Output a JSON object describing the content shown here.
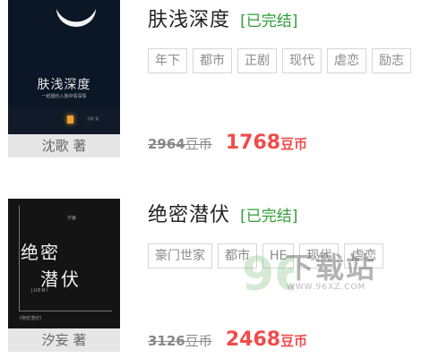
{
  "books": [
    {
      "title": "肤浅深度",
      "status": "[已完结]",
      "tags": [
        "年下",
        "都市",
        "正剧",
        "现代",
        "虐恋",
        "励志"
      ],
      "author_line": "沈歌 著",
      "old_price": "2964",
      "new_price": "1768",
      "price_unit": "豆币",
      "cover": {
        "title": "肤浅深度",
        "subtitle": "一纸婚约入我中情深情",
        "credit": "沈歌 著"
      }
    },
    {
      "title": "绝密潜伏",
      "status": "[已完结]",
      "tags": [
        "豪门世家",
        "都市",
        "HE",
        "现代",
        "虐恋"
      ],
      "author_line": "汐妄 著",
      "old_price": "3126",
      "new_price": "2468",
      "price_unit": "豆币",
      "cover": {
        "line1": "绝密",
        "line2": "潜伏",
        "english": "JUEMI",
        "small_author": "汐妄",
        "bottom": "《绝密潜伏》"
      }
    }
  ],
  "watermark": {
    "logo_digits": "96",
    "text": "下载站",
    "url": "WWW.96XZ.COM"
  },
  "colors": {
    "status_green": "#2e9e35",
    "price_red": "#f24b4b",
    "tag_border": "#d6d6d6"
  }
}
